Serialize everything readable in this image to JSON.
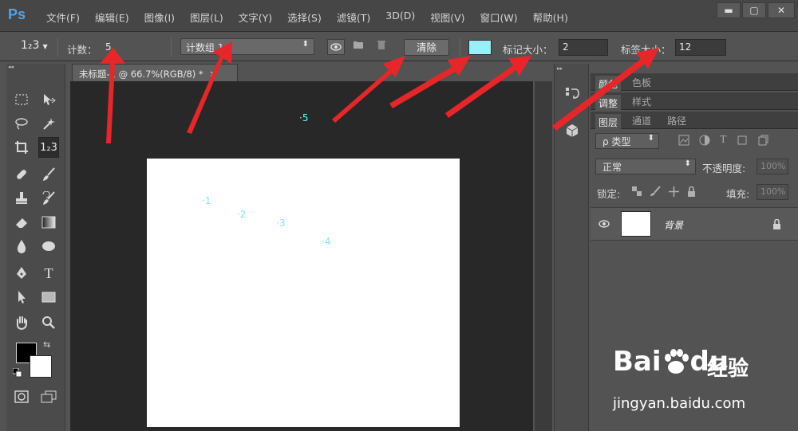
{
  "app": {
    "logo": "Ps"
  },
  "menu": [
    "文件(F)",
    "编辑(E)",
    "图像(I)",
    "图层(L)",
    "文字(Y)",
    "选择(S)",
    "滤镜(T)",
    "3D(D)",
    "视图(V)",
    "窗口(W)",
    "帮助(H)"
  ],
  "window_controls": {
    "minimize": "▬",
    "maximize": "▢",
    "close": "✕"
  },
  "options": {
    "tool_glyph": "1₂3",
    "count_label": "计数：",
    "count_value": "5",
    "group_value": "计数组  1",
    "clear_label": "清除",
    "marker_color": "#9aeef8",
    "marker_size_label": "标记大小：",
    "marker_size_value": "2",
    "label_size_label": "标签大小：",
    "label_size_value": "12"
  },
  "document": {
    "tab_title": "未标题-1 @ 66.7%(RGB/8) *",
    "marks": [
      {
        "label": "1"
      },
      {
        "label": "2"
      },
      {
        "label": "3"
      },
      {
        "label": "4"
      },
      {
        "label": "5"
      }
    ]
  },
  "panels": {
    "row1_tabs": [
      "颜色",
      "色板"
    ],
    "row2_tabs": [
      "调整",
      "样式"
    ],
    "row3_tabs": [
      "图层",
      "通道",
      "路径"
    ],
    "filter_kind": "ρ 类型",
    "blend_mode": "正常",
    "opacity_label": "不透明度:",
    "opacity_value": "100%",
    "lock_label": "锁定:",
    "fill_label": "填充:",
    "fill_value": "100%",
    "layer_name": "背景"
  },
  "colors": {
    "foreground": "#000000",
    "background": "#ffffff",
    "mark": "#7fe8f0",
    "arrow": "#e8262a"
  },
  "watermark": {
    "brand": "Bai",
    "brand2": "du",
    "site_label": "经验",
    "url": "jingyan.baidu.com"
  }
}
